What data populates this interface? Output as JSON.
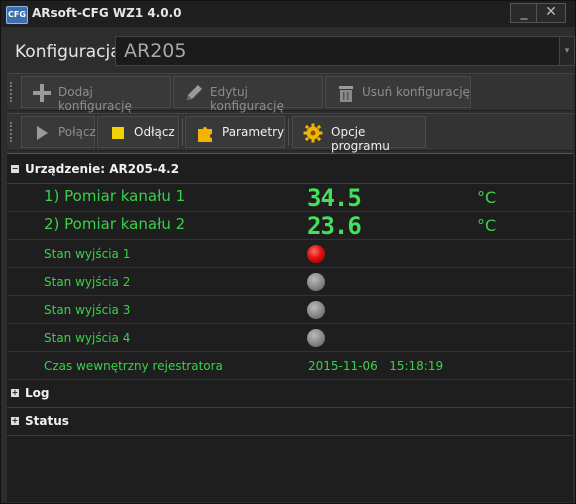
{
  "window": {
    "title": "ARsoft-CFG WZ1 4.0.0",
    "icon_text": "CFG",
    "minimize_glyph": "_",
    "close_glyph": "✕"
  },
  "config": {
    "label": "Konfiguracja",
    "value": "AR205",
    "arrow_glyph": "▾"
  },
  "toolbar1": {
    "add_label": "Dodaj konfigurację",
    "edit_label": "Edytuj konfigurację",
    "delete_label": "Usuń konfigurację"
  },
  "toolbar2": {
    "connect_label": "Połącz",
    "disconnect_label": "Odłącz",
    "params_label": "Parametry",
    "options_label": "Opcje programu"
  },
  "device": {
    "header": "Urządzenie: AR205-4.2",
    "expander": "−",
    "channel1": {
      "name": "1) Pomiar kanału 1",
      "value": "34.5",
      "unit": "°C"
    },
    "channel2": {
      "name": "2) Pomiar kanału 2",
      "value": "23.6",
      "unit": "°C"
    },
    "outputs": [
      {
        "name": "Stan wyjścia 1",
        "state": "on"
      },
      {
        "name": "Stan wyjścia 2",
        "state": "off"
      },
      {
        "name": "Stan wyjścia 3",
        "state": "off"
      },
      {
        "name": "Stan wyjścia 4",
        "state": "off"
      }
    ],
    "clock": {
      "name": "Czas wewnętrzny rejestratora",
      "date": "2015-11-06",
      "time": "15:18:19"
    }
  },
  "log_section": {
    "header": "Log",
    "expander": "+"
  },
  "status_section": {
    "header": "Status",
    "expander": "+"
  },
  "colors": {
    "accent_green": "#39d14a",
    "led_on": "#e01010",
    "led_off": "#8a8a8a"
  }
}
